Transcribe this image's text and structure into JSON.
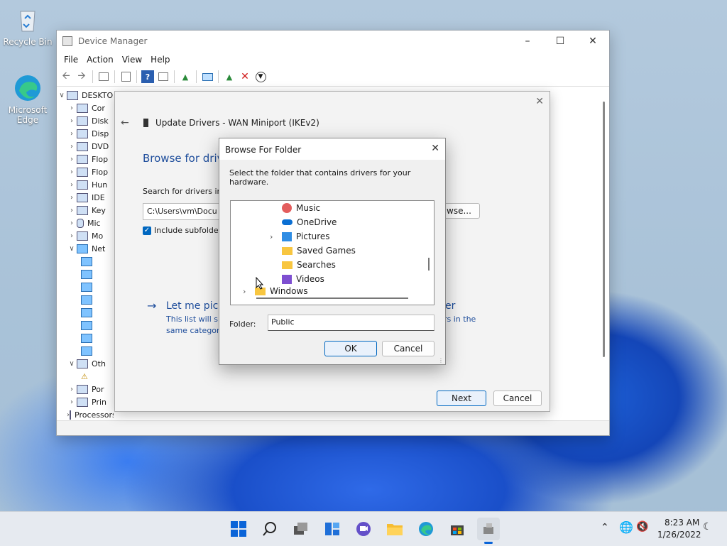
{
  "desktop": {
    "recycle_bin_label": "Recycle Bin",
    "edge_label": "Microsoft Edge"
  },
  "device_manager": {
    "title": "Device Manager",
    "menu": [
      "File",
      "Action",
      "View",
      "Help"
    ],
    "tree_root": "DESKTO",
    "tree_items": [
      {
        "label": "Cor",
        "expanded": false
      },
      {
        "label": "Disk",
        "expanded": false
      },
      {
        "label": "Disp",
        "expanded": false
      },
      {
        "label": "DVD",
        "expanded": false
      },
      {
        "label": "Flop",
        "expanded": false
      },
      {
        "label": "Flop",
        "expanded": false
      },
      {
        "label": "Hun",
        "expanded": false
      },
      {
        "label": "IDE",
        "expanded": false
      },
      {
        "label": "Key",
        "expanded": false
      },
      {
        "label": "Mic",
        "expanded": false
      },
      {
        "label": "Mo",
        "expanded": false
      },
      {
        "label": "Net",
        "expanded": true
      }
    ],
    "tree_items_after": [
      {
        "label": "Oth",
        "expanded": true
      },
      {
        "label": "Por",
        "expanded": false
      },
      {
        "label": "Prin",
        "expanded": false
      },
      {
        "label": "Processors",
        "expanded": false
      }
    ]
  },
  "wizard": {
    "title": "Update Drivers - WAN Miniport (IKEv2)",
    "heading": "Browse for driv",
    "search_label": "Search for drivers in t",
    "path_value": "C:\\Users\\vm\\Docu",
    "browse_label": "wse...",
    "include_subfolders_label": "Include subfolder",
    "pick_link_left": "Let me pick",
    "pick_link_right": "er",
    "pick_desc_left_1": "This list will sh",
    "pick_desc_left_2": "same category",
    "pick_desc_right": "rs in the",
    "next_label": "Next",
    "cancel_label": "Cancel"
  },
  "browse_dialog": {
    "title": "Browse For Folder",
    "instruction": "Select the folder that contains drivers for your hardware.",
    "folders": [
      {
        "label": "Music",
        "icon": "music-icon",
        "chevron": false
      },
      {
        "label": "OneDrive",
        "icon": "onedrive-icon",
        "chevron": false
      },
      {
        "label": "Pictures",
        "icon": "pictures-icon",
        "chevron": true
      },
      {
        "label": "Saved Games",
        "icon": "folder-icon",
        "chevron": false
      },
      {
        "label": "Searches",
        "icon": "folder-icon",
        "chevron": false
      },
      {
        "label": "Videos",
        "icon": "videos-icon",
        "chevron": false
      },
      {
        "label": "Windows",
        "icon": "folder-icon",
        "chevron": true
      }
    ],
    "folder_label": "Folder:",
    "folder_value": "Public",
    "ok_label": "OK",
    "cancel_label": "Cancel"
  },
  "taskbar": {
    "time": "8:23 AM",
    "date": "1/26/2022"
  }
}
